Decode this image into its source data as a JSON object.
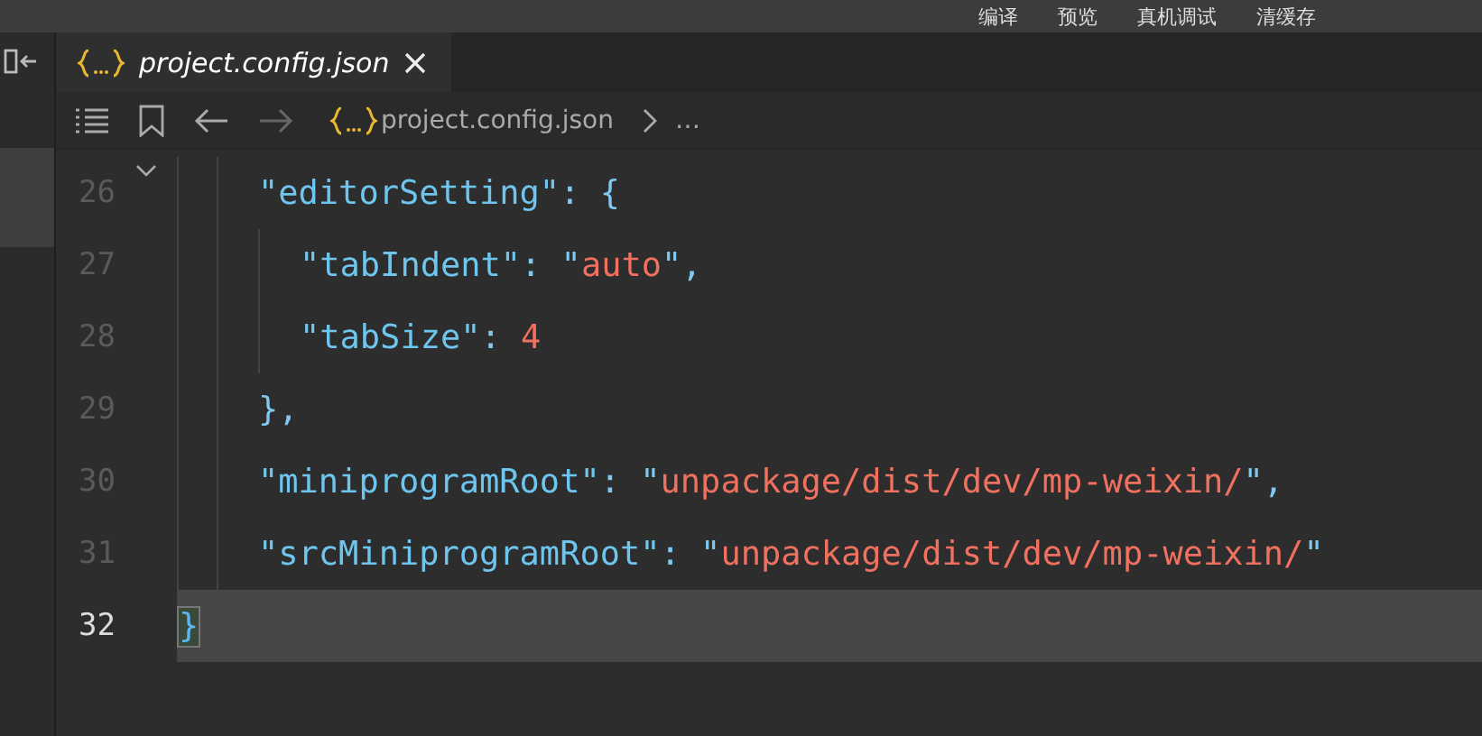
{
  "top_menu": [
    "编译",
    "预览",
    "真机调试",
    "清缓存"
  ],
  "tabs": [
    {
      "label": "project.config.json",
      "selected": true
    }
  ],
  "breadcrumb": {
    "file": "project.config.json",
    "more": "…"
  },
  "lines": [
    {
      "kind": "group",
      "children": [
        {
          "kind": "line",
          "number": "26",
          "current": false,
          "fold": true,
          "tokens": [
            {
              "kind": "key",
              "text": "\"editorSetting\""
            },
            {
              "kind": "punct",
              "text": ": {"
            }
          ],
          "children": [
            {
              "kind": "line",
              "number": "27",
              "current": false,
              "fold": false,
              "tokens": [
                {
                  "kind": "key",
                  "text": "\"tabIndent\""
                },
                {
                  "kind": "punct",
                  "text": ": \""
                },
                {
                  "kind": "string",
                  "text": "auto"
                },
                {
                  "kind": "punct",
                  "text": "\","
                }
              ]
            },
            {
              "kind": "line",
              "number": "28",
              "current": false,
              "fold": false,
              "tokens": [
                {
                  "kind": "key",
                  "text": "\"tabSize\""
                },
                {
                  "kind": "punct",
                  "text": ": "
                },
                {
                  "kind": "number",
                  "text": "4"
                }
              ]
            }
          ]
        },
        {
          "kind": "line",
          "number": "29",
          "current": false,
          "fold": false,
          "tokens": [
            {
              "kind": "punct",
              "text": "},"
            }
          ]
        },
        {
          "kind": "line",
          "number": "30",
          "current": false,
          "fold": false,
          "tokens": [
            {
              "kind": "key",
              "text": "\"miniprogramRoot\""
            },
            {
              "kind": "punct",
              "text": ": \""
            },
            {
              "kind": "string",
              "text": "unpackage/dist/dev/mp-weixin/"
            },
            {
              "kind": "punct",
              "text": "\","
            }
          ]
        },
        {
          "kind": "line",
          "number": "31",
          "current": false,
          "fold": false,
          "tokens": [
            {
              "kind": "key",
              "text": "\"srcMiniprogramRoot\""
            },
            {
              "kind": "punct",
              "text": ": \""
            },
            {
              "kind": "string",
              "text": "unpackage/dist/dev/mp-weixin/"
            },
            {
              "kind": "punct",
              "text": "\""
            }
          ]
        }
      ]
    },
    {
      "kind": "line",
      "number": "32",
      "current": true,
      "fold": false,
      "tokens": [
        {
          "kind": "bracket",
          "text": "}"
        }
      ]
    }
  ]
}
